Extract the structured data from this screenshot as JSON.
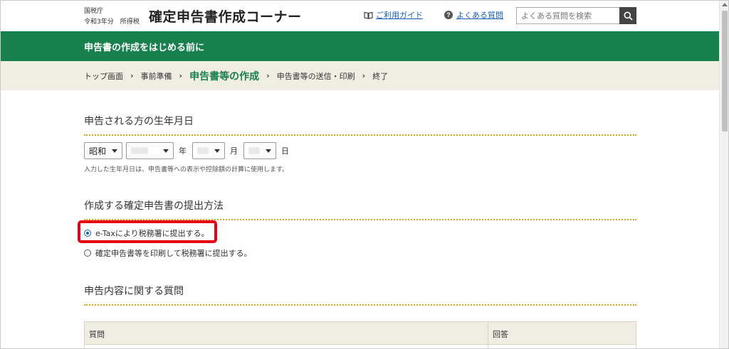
{
  "header": {
    "agency": "国税庁",
    "year": "令和3年分",
    "tax_type": "所得税",
    "title": "確定申告書作成コーナー",
    "guide_link": "ご利用ガイド",
    "faq_link": "よくある質問",
    "search_placeholder": "よくある質問を検索"
  },
  "banner": {
    "title": "申告書の作成をはじめる前に"
  },
  "breadcrumb": {
    "items": [
      {
        "label": "トップ画面"
      },
      {
        "label": "事前準備"
      },
      {
        "label": "申告書等の作成",
        "current": true
      },
      {
        "label": "申告書等の送信・印刷"
      },
      {
        "label": "終了"
      }
    ]
  },
  "dob_section": {
    "heading": "申告される方の生年月日",
    "era_value": "昭和",
    "year_unit": "年",
    "month_unit": "月",
    "day_unit": "日",
    "note": "入力した生年月日は、申告書等への表示や控除額の計算に使用します。"
  },
  "submit_section": {
    "heading": "作成する確定申告書の提出方法",
    "options": [
      {
        "label": "e-Taxにより税務署に提出する。",
        "checked": true
      },
      {
        "label": "確定申告書等を印刷して税務署に提出する。",
        "checked": false
      }
    ]
  },
  "questions_section": {
    "heading": "申告内容に関する質問",
    "columns": [
      "質問",
      "回答"
    ]
  },
  "colors": {
    "brand_green": "#18804d",
    "breadcrumb_bg": "#f0ede2",
    "dotted_rule": "#e3a21a",
    "highlight_red": "#e60012",
    "link_blue": "#1a5fb4"
  }
}
